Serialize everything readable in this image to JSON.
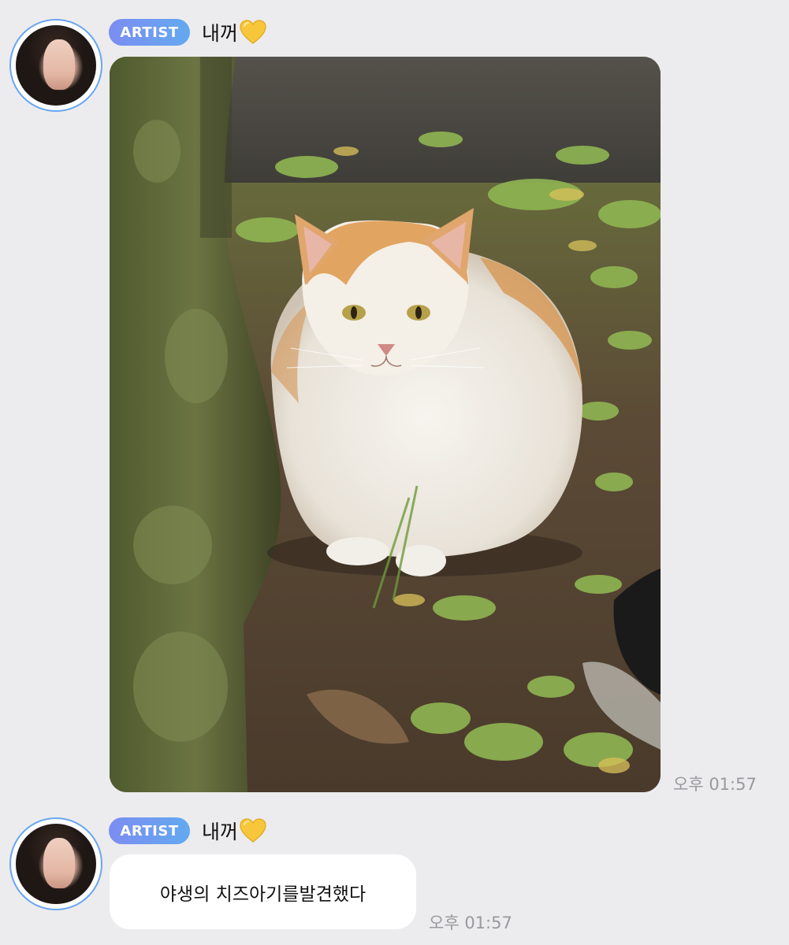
{
  "messages": [
    {
      "badge": "ARTIST",
      "sender": "내꺼",
      "sender_icon": "yellow-heart-icon",
      "content_type": "image",
      "image_alt": "orange and white cat sitting under a tree",
      "time": "오후 01:57"
    },
    {
      "badge": "ARTIST",
      "sender": "내꺼",
      "sender_icon": "yellow-heart-icon",
      "content_type": "text",
      "text": "야생의 치즈아기를발견했다",
      "time": "오후 01:57"
    }
  ],
  "colors": {
    "background": "#ececee",
    "badge_gradient_start": "#7c8df2",
    "badge_gradient_end": "#63a9ef",
    "avatar_ring": "#6aa6f2",
    "time_text": "#9a9a9e",
    "heart": "#f7c63a"
  }
}
